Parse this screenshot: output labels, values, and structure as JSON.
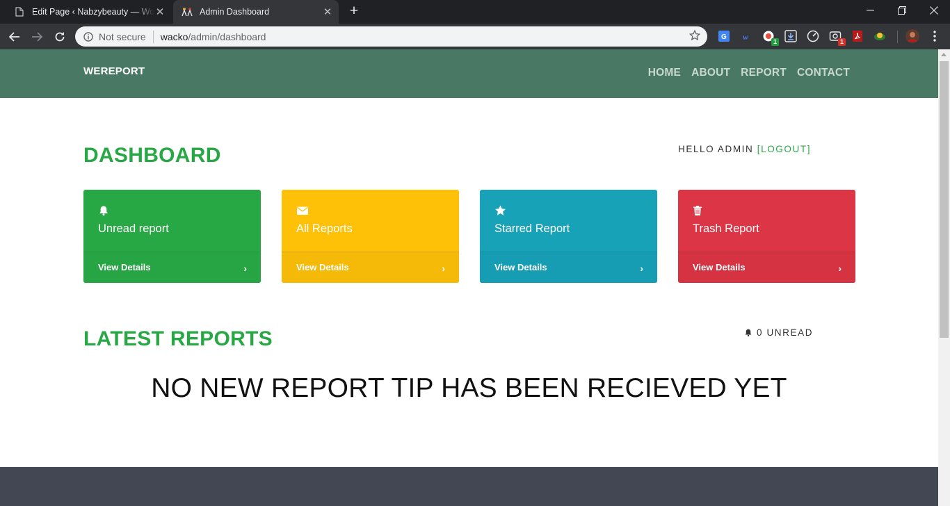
{
  "browser": {
    "tabs": [
      {
        "title": "Edit Page ‹ Nabzybeauty — WordPress",
        "active": false
      },
      {
        "title": "Admin Dashboard",
        "active": true
      }
    ],
    "security_label": "Not secure",
    "url_host": "wacko",
    "url_path": "/admin/dashboard",
    "extension_badges": [
      "1",
      "1"
    ]
  },
  "site": {
    "brand": "WEREPORT",
    "menu": [
      "HOME",
      "ABOUT",
      "REPORT",
      "CONTACT"
    ]
  },
  "dashboard": {
    "title": "DASHBOARD",
    "greeting": "HELLO ADMIN",
    "logout_label": "[LOGOUT]",
    "cards": [
      {
        "label": "Unread report",
        "icon": "bell-icon",
        "footer": "View Details",
        "color": "#28a745"
      },
      {
        "label": "All Reports",
        "icon": "envelope-icon",
        "footer": "View Details",
        "color": "#ffc107"
      },
      {
        "label": "Starred Report",
        "icon": "star-icon",
        "footer": "View Details",
        "color": "#17a2b8"
      },
      {
        "label": "Trash Report",
        "icon": "trash-icon",
        "footer": "View Details",
        "color": "#dc3545"
      }
    ]
  },
  "latest": {
    "title": "LATEST REPORTS",
    "unread_text": "0 UNREAD",
    "empty_message": "NO NEW REPORT TIP HAS BEEN RECIEVED YET"
  }
}
